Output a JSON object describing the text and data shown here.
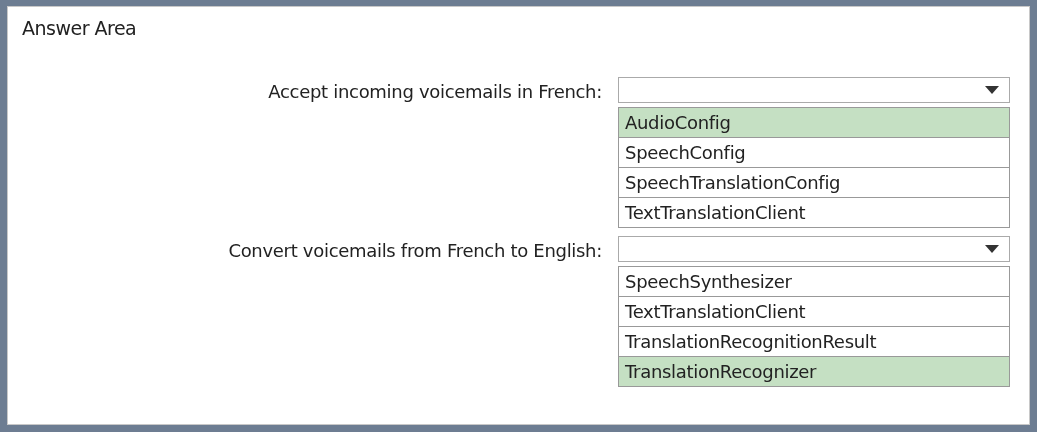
{
  "title": "Answer Area",
  "questions": [
    {
      "label": "Accept incoming voicemails in French:",
      "options": [
        {
          "label": "AudioConfig",
          "selected": true
        },
        {
          "label": "SpeechConfig",
          "selected": false
        },
        {
          "label": "SpeechTranslationConfig",
          "selected": false
        },
        {
          "label": "TextTranslationClient",
          "selected": false
        }
      ]
    },
    {
      "label": "Convert voicemails from French to English:",
      "options": [
        {
          "label": "SpeechSynthesizer",
          "selected": false
        },
        {
          "label": "TextTranslationClient",
          "selected": false
        },
        {
          "label": "TranslationRecognitionResult",
          "selected": false
        },
        {
          "label": "TranslationRecognizer",
          "selected": true
        }
      ]
    }
  ]
}
